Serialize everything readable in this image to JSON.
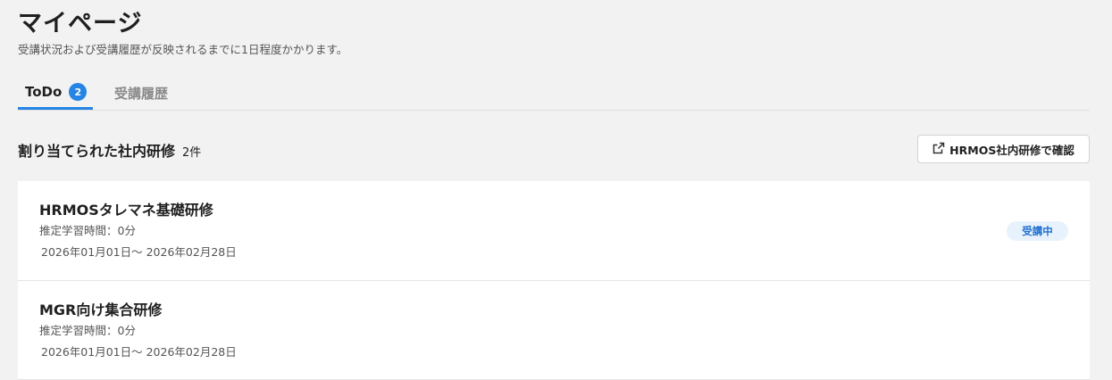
{
  "header": {
    "title": "マイページ",
    "subtitle": "受講状況および受講履歴が反映されるまでに1日程度かかります。"
  },
  "tabs": [
    {
      "label": "ToDo",
      "badge": "2",
      "active": true
    },
    {
      "label": "受講履歴",
      "active": false
    }
  ],
  "section": {
    "title": "割り当てられた社内研修",
    "count": "2件",
    "action_label": "HRMOS社内研修で確認",
    "action_icon": "external-link-icon"
  },
  "courses": [
    {
      "title": "HRMOSタレマネ基礎研修",
      "study_time": "推定学習時間：0分",
      "period": "2026年01月01日〜 2026年02月28日",
      "status": "受講中"
    },
    {
      "title": "MGR向け集合研修",
      "study_time": "推定学習時間：0分",
      "period": "2026年01月01日〜 2026年02月28日"
    }
  ],
  "colors": {
    "accent": "#2684e5",
    "status_bg": "#e8f2fd",
    "status_text": "#2170cf",
    "background": "#f2f2f3"
  }
}
